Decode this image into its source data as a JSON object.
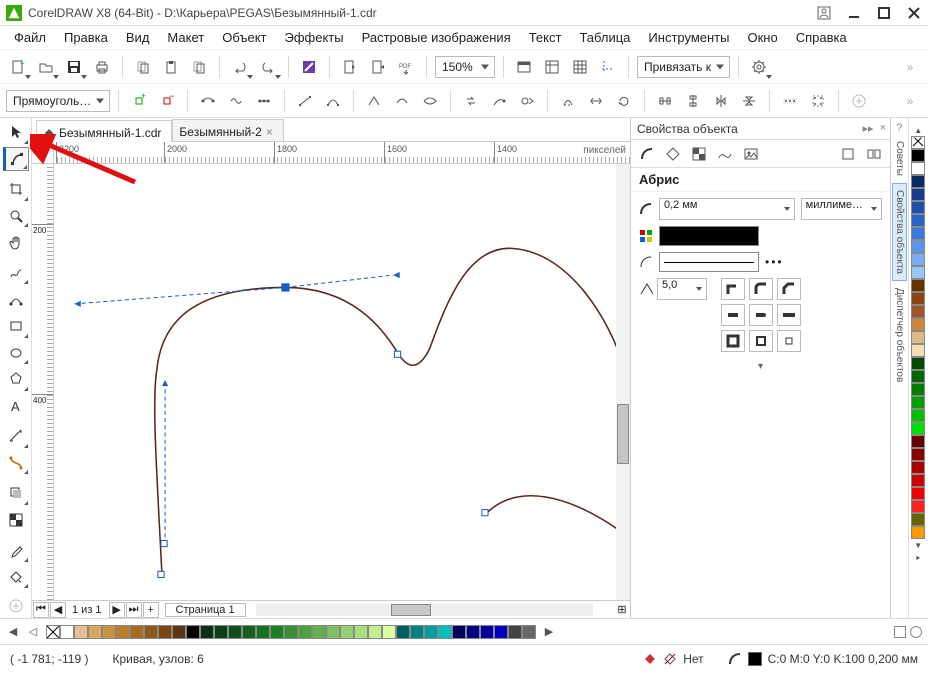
{
  "app": {
    "title": "CorelDRAW X8 (64-Bit) - D:\\Карьера\\PEGAS\\Безымянный-1.cdr"
  },
  "menu": {
    "file": "Файл",
    "edit": "Правка",
    "view": "Вид",
    "layout": "Макет",
    "object": "Объект",
    "effects": "Эффекты",
    "bitmaps": "Растровые изображения",
    "text": "Текст",
    "table": "Таблица",
    "tools": "Инструменты",
    "window": "Окно",
    "help": "Справка"
  },
  "toolbar": {
    "zoom_value": "150%",
    "snap_label": "Привязать к"
  },
  "propbar": {
    "selection_mode": "Прямоуголь…"
  },
  "tabs": {
    "doc1": "Безымянный-1.cdr",
    "doc2": "Безымянный-2"
  },
  "ruler": {
    "unit_label": "пикселей",
    "h_ticks": [
      "2200",
      "2000",
      "1800",
      "1600",
      "1400"
    ],
    "v_ticks": [
      "200",
      "400"
    ]
  },
  "pagebar": {
    "count": "1 из 1",
    "page_tab": "Страница 1"
  },
  "docker": {
    "title": "Свойства объекта",
    "section": "Абрис",
    "width_value": "0,2 мм",
    "width_unit": "миллиме…",
    "miter_value": "5,0"
  },
  "side_tabs": {
    "hints": "Советы",
    "props": "Свойства объекта",
    "mgr": "Диспетчер объектов"
  },
  "palette": {
    "colors": [
      "#000000",
      "#ffffff",
      "#0a2a66",
      "#163c8c",
      "#1e4faa",
      "#2b64c8",
      "#3d7ae0",
      "#5b93ee",
      "#7aadf4",
      "#99c6fa",
      "#663300",
      "#8b4513",
      "#a0522d",
      "#cd853f",
      "#deb887",
      "#f5deb3",
      "#004d00",
      "#006600",
      "#008000",
      "#00a000",
      "#00c000",
      "#00e000",
      "#660000",
      "#880000",
      "#aa0000",
      "#cc0000",
      "#ee0000",
      "#ff2020",
      "#666600",
      "#ff9900"
    ]
  },
  "attrib_palette": {
    "colors": [
      "#ffffff",
      "#e8c090",
      "#d8a860",
      "#c89440",
      "#b88030",
      "#a86c20",
      "#905818",
      "#784410",
      "#603410",
      "#000000",
      "#083010",
      "#0c4014",
      "#105018",
      "#14601c",
      "#187020",
      "#1c8024",
      "#349030",
      "#4ca040",
      "#64b050",
      "#7cc060",
      "#94d070",
      "#acdf80",
      "#c4ef90",
      "#dcffa0",
      "#006060",
      "#008080",
      "#00a0a0",
      "#00c0c0",
      "#000060",
      "#000080",
      "#0000a0",
      "#0000c0",
      "#444444",
      "#666666"
    ]
  },
  "status": {
    "coords": "( -1 781; -119 )",
    "object_info": "Кривая, узлов: 6",
    "fill_label": "Нет",
    "outline_info": "C:0 M:0 Y:0 K:100  0,200 мм"
  },
  "chart_data": {
    "type": "vector-curve",
    "description": "Bezier curve being edited with Shape tool; one node selected with visible control handles.",
    "selected_node_index": 1,
    "nodes": 6
  }
}
